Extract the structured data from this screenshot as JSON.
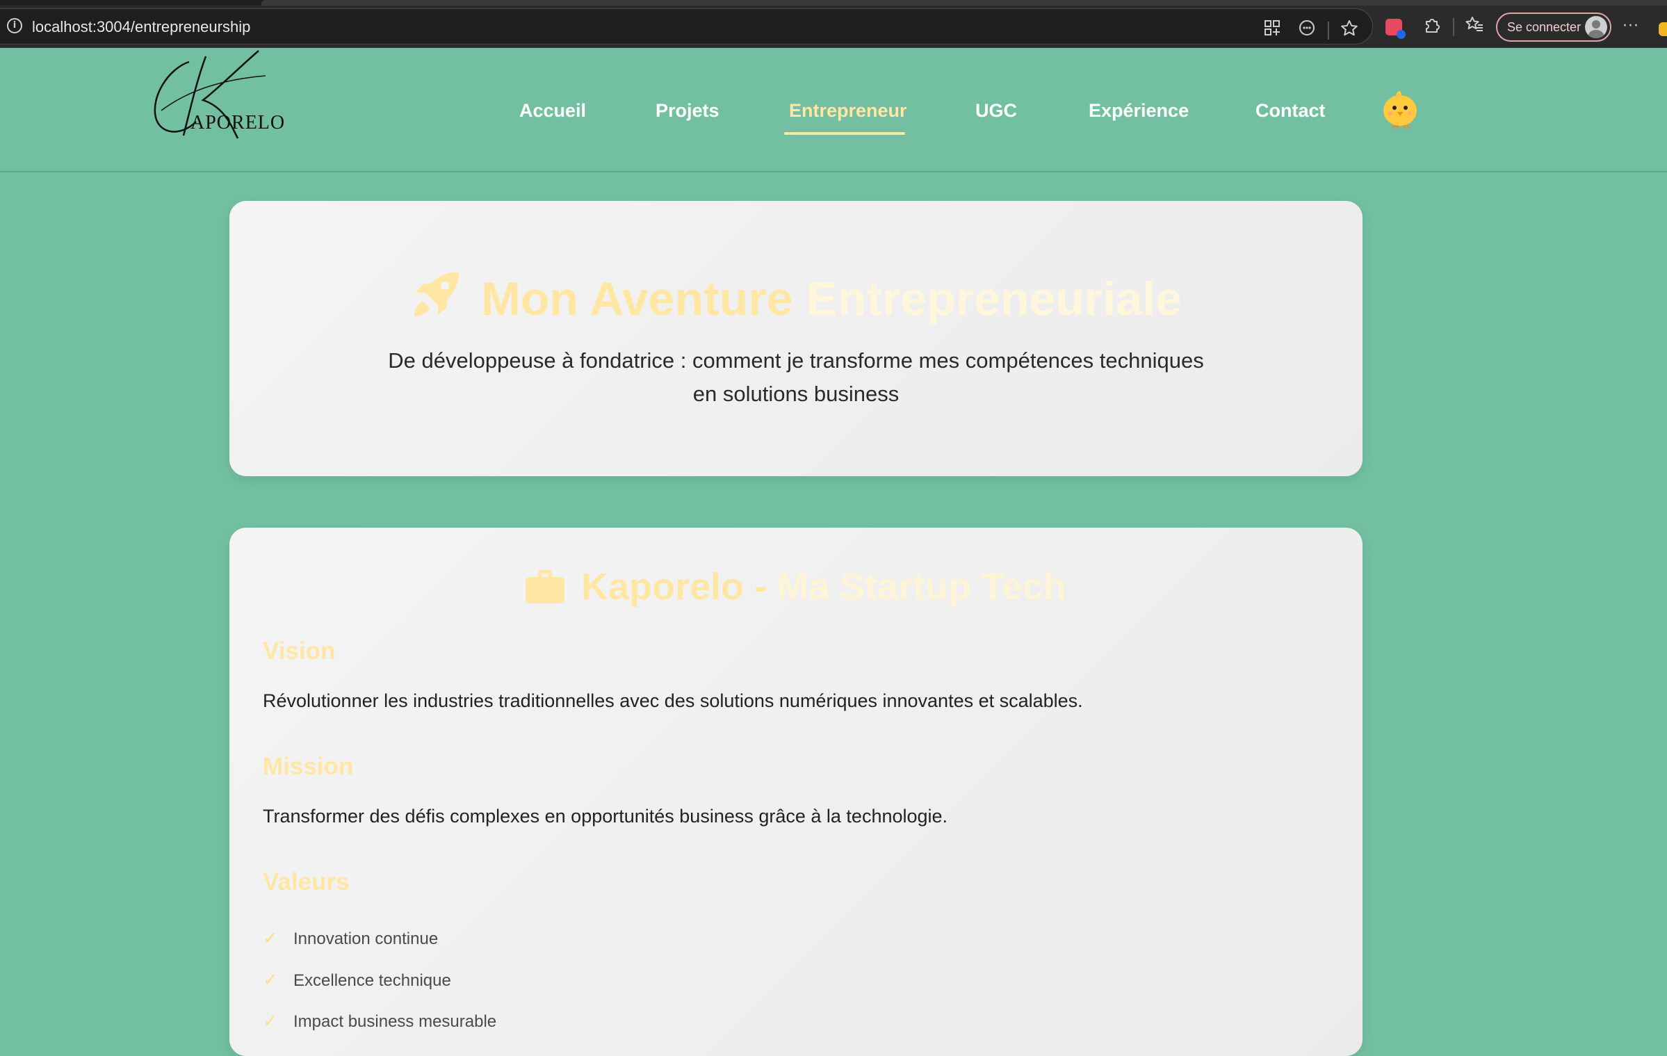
{
  "browser": {
    "url": "localhost:3004/entrepreneurship",
    "signin_label": "Se connecter",
    "icons": [
      "info-icon",
      "app-grid-icon",
      "reading-mode-icon",
      "favorite-star-icon",
      "extension-icon",
      "puzzle-extensions-icon",
      "favorites-icon",
      "more-icon",
      "copilot-icon"
    ],
    "more_glyph": "···"
  },
  "header": {
    "logo_initial": "K",
    "logo_text": "APORELO",
    "nav": [
      {
        "label": "Accueil"
      },
      {
        "label": "Projets"
      },
      {
        "label": "Entrepreneur",
        "active": true
      },
      {
        "label": "UGC"
      },
      {
        "label": "Expérience"
      },
      {
        "label": "Contact"
      }
    ],
    "mascot_icon": "chick-icon"
  },
  "hero": {
    "icon": "rocket-icon",
    "title_part1": "Mon Aventure ",
    "title_part2": "Entrepreneuriale",
    "subtitle": "De développeuse à fondatrice : comment je transforme mes compétences techniques en solutions business"
  },
  "startup": {
    "icon": "briefcase-icon",
    "title_part1": "Kaporelo - ",
    "title_part2": "Ma Startup Tech",
    "vision_heading": "Vision",
    "vision_text": "Révolutionner les industries traditionnelles avec des solutions numériques innovantes et scalables.",
    "mission_heading": "Mission",
    "mission_text": "Transformer des défis complexes en opportunités business grâce à la technologie.",
    "values_heading": "Valeurs",
    "check_glyph": "✓",
    "values": [
      "Innovation continue",
      "Excellence technique",
      "Impact business mesurable"
    ]
  },
  "colors": {
    "background": "#72bfa1",
    "accent_yellow": "#ffe7a3",
    "card": "#f0f0f0",
    "text": "#222222"
  }
}
